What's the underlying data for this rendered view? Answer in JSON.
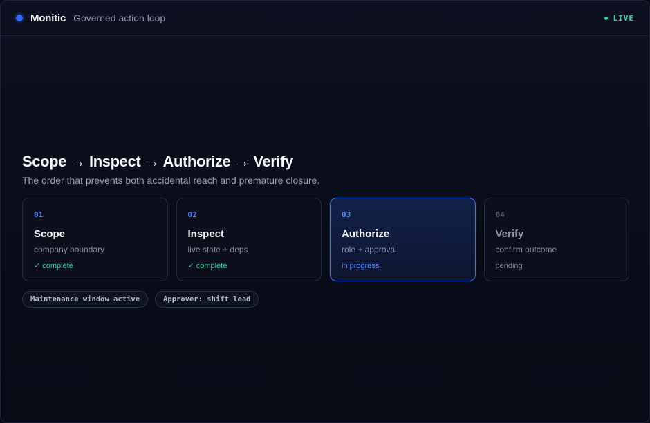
{
  "header": {
    "brand": "Monitic",
    "subtitle": "Governed action loop",
    "live_label": "LIVE"
  },
  "main": {
    "title": "Scope → Inspect → Authorize → Verify",
    "subtitle": "The order that prevents both accidental reach and premature closure.",
    "steps": [
      {
        "num": "01",
        "title": "Scope",
        "desc": "company boundary",
        "status": "✓ complete",
        "state": "complete"
      },
      {
        "num": "02",
        "title": "Inspect",
        "desc": "live state + deps",
        "status": "✓ complete",
        "state": "complete"
      },
      {
        "num": "03",
        "title": "Authorize",
        "desc": "role + approval",
        "status": "in progress",
        "state": "in-progress"
      },
      {
        "num": "04",
        "title": "Verify",
        "desc": "confirm outcome",
        "status": "pending",
        "state": "pending"
      }
    ],
    "tags": [
      "Maintenance window active",
      "Approver: shift lead"
    ]
  },
  "colors": {
    "accent": "#3b74f0",
    "complete": "#34d399",
    "live": "#34d399",
    "background": "#0a0d1a"
  }
}
